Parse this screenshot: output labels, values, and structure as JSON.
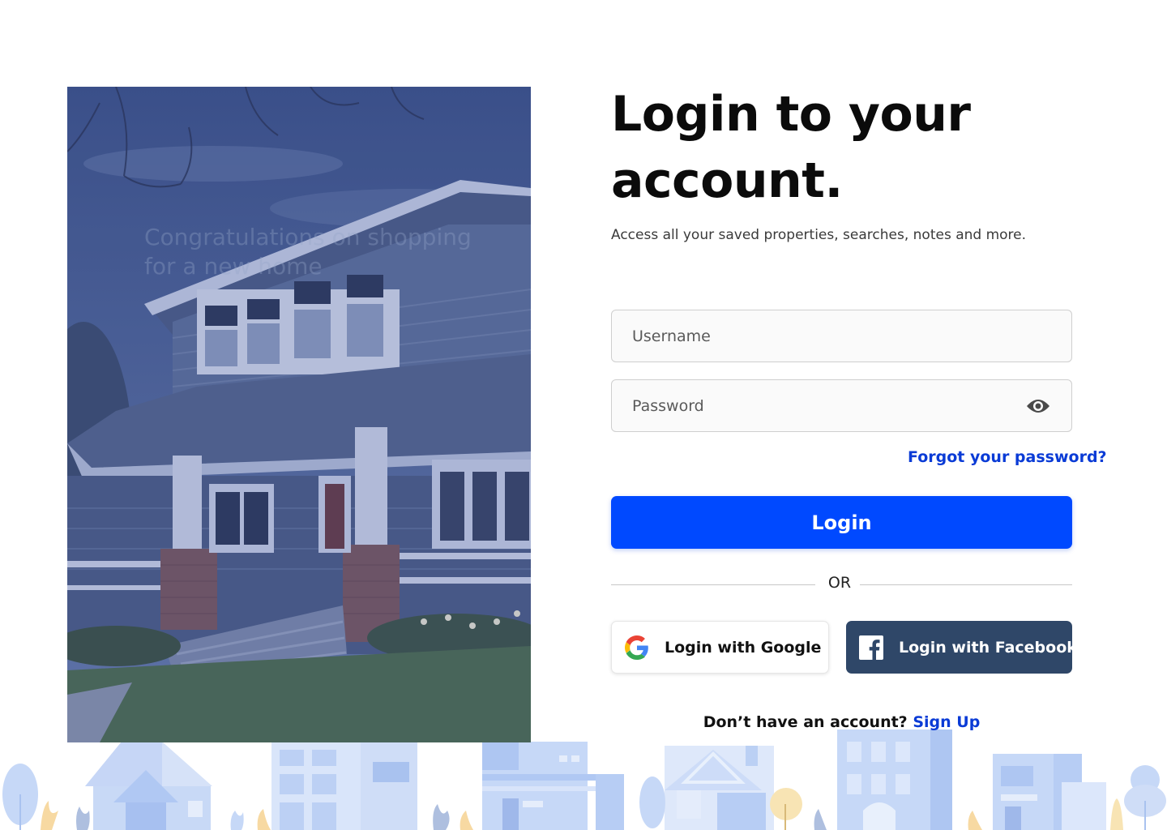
{
  "hero": {
    "ghost_text": "Congratulations on shopping for a new home"
  },
  "form": {
    "title": "Login to your account.",
    "subtitle": "Access all your saved properties, searches, notes and more.",
    "username_placeholder": "Username",
    "username_value": "",
    "password_placeholder": "Password",
    "password_value": "",
    "password_toggle_icon": "eye-icon",
    "forgot_label": "Forgot your password?",
    "login_label": "Login",
    "divider_label": "OR",
    "google_label": "Login with Google",
    "google_icon": "google-icon",
    "facebook_label": "Login with Facebook",
    "facebook_icon": "facebook-icon",
    "signup_prompt": "Don’t have an account?",
    "signup_link": "Sign Up"
  },
  "colors": {
    "primary": "#0049ff",
    "link": "#0a3bd6",
    "facebook": "#2f4768",
    "text": "#0b0b0b"
  }
}
